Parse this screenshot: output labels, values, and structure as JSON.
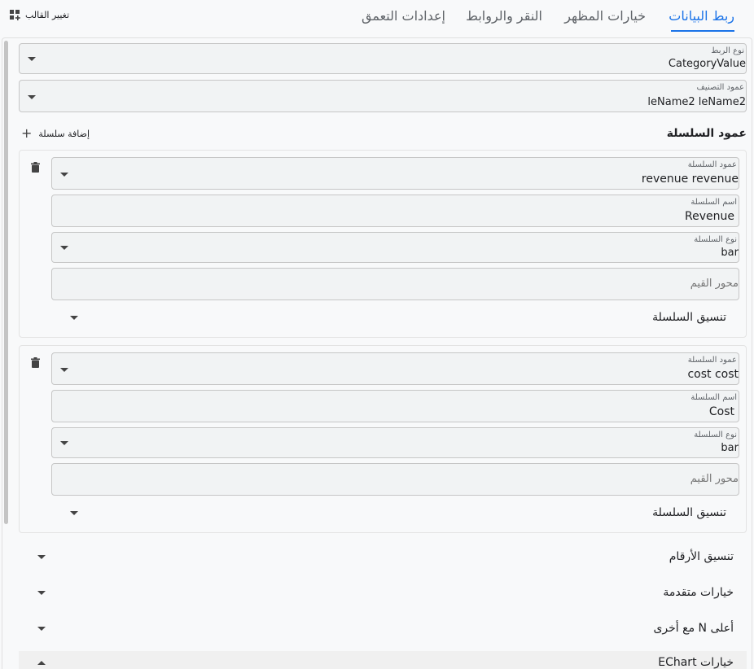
{
  "tabs": [
    {
      "label": "ربط البيانات",
      "active": true
    },
    {
      "label": "خيارات المظهر",
      "active": false
    },
    {
      "label": "النقر والروابط",
      "active": false
    },
    {
      "label": "إعدادات التعمق",
      "active": false
    }
  ],
  "toolbar": {
    "change_template": "تغيير القالب"
  },
  "binding": {
    "type_label": "نوع الربط",
    "type_value": "CategoryValue",
    "category_label": "عمود التصنيف",
    "category_value": "leName2 leName2"
  },
  "series_section": {
    "title": "عمود السلسلة",
    "add_label": "إضافة سلسلة"
  },
  "series": [
    {
      "column_label": "عمود السلسلة",
      "column_value": "revenue revenue",
      "name_label": "اسم السلسلة",
      "name_value": "Revenue",
      "type_label": "نوع السلسلة",
      "type_value": "bar",
      "axis_placeholder": "محور القيم",
      "format_label": "تنسيق السلسلة"
    },
    {
      "column_label": "عمود السلسلة",
      "column_value": "cost cost",
      "name_label": "اسم السلسلة",
      "name_value": "Cost",
      "type_label": "نوع السلسلة",
      "type_value": "bar",
      "axis_placeholder": "محور القيم",
      "format_label": "تنسيق السلسلة"
    }
  ],
  "accordions": [
    {
      "label": "تنسيق الأرقام",
      "expanded": false
    },
    {
      "label": "خيارات متقدمة",
      "expanded": false
    },
    {
      "label": "أعلى N مع أخرى",
      "expanded": false
    },
    {
      "label": "خيارات EChart",
      "expanded": true
    }
  ],
  "colors": {
    "accent": "#1a73e8",
    "field_bg": "#f1f3f4",
    "border": "#c6c6c6"
  },
  "icons": {
    "template": "grid-plus-icon",
    "delete": "trash-icon",
    "add": "plus-icon",
    "expand": "caret-down-icon"
  }
}
